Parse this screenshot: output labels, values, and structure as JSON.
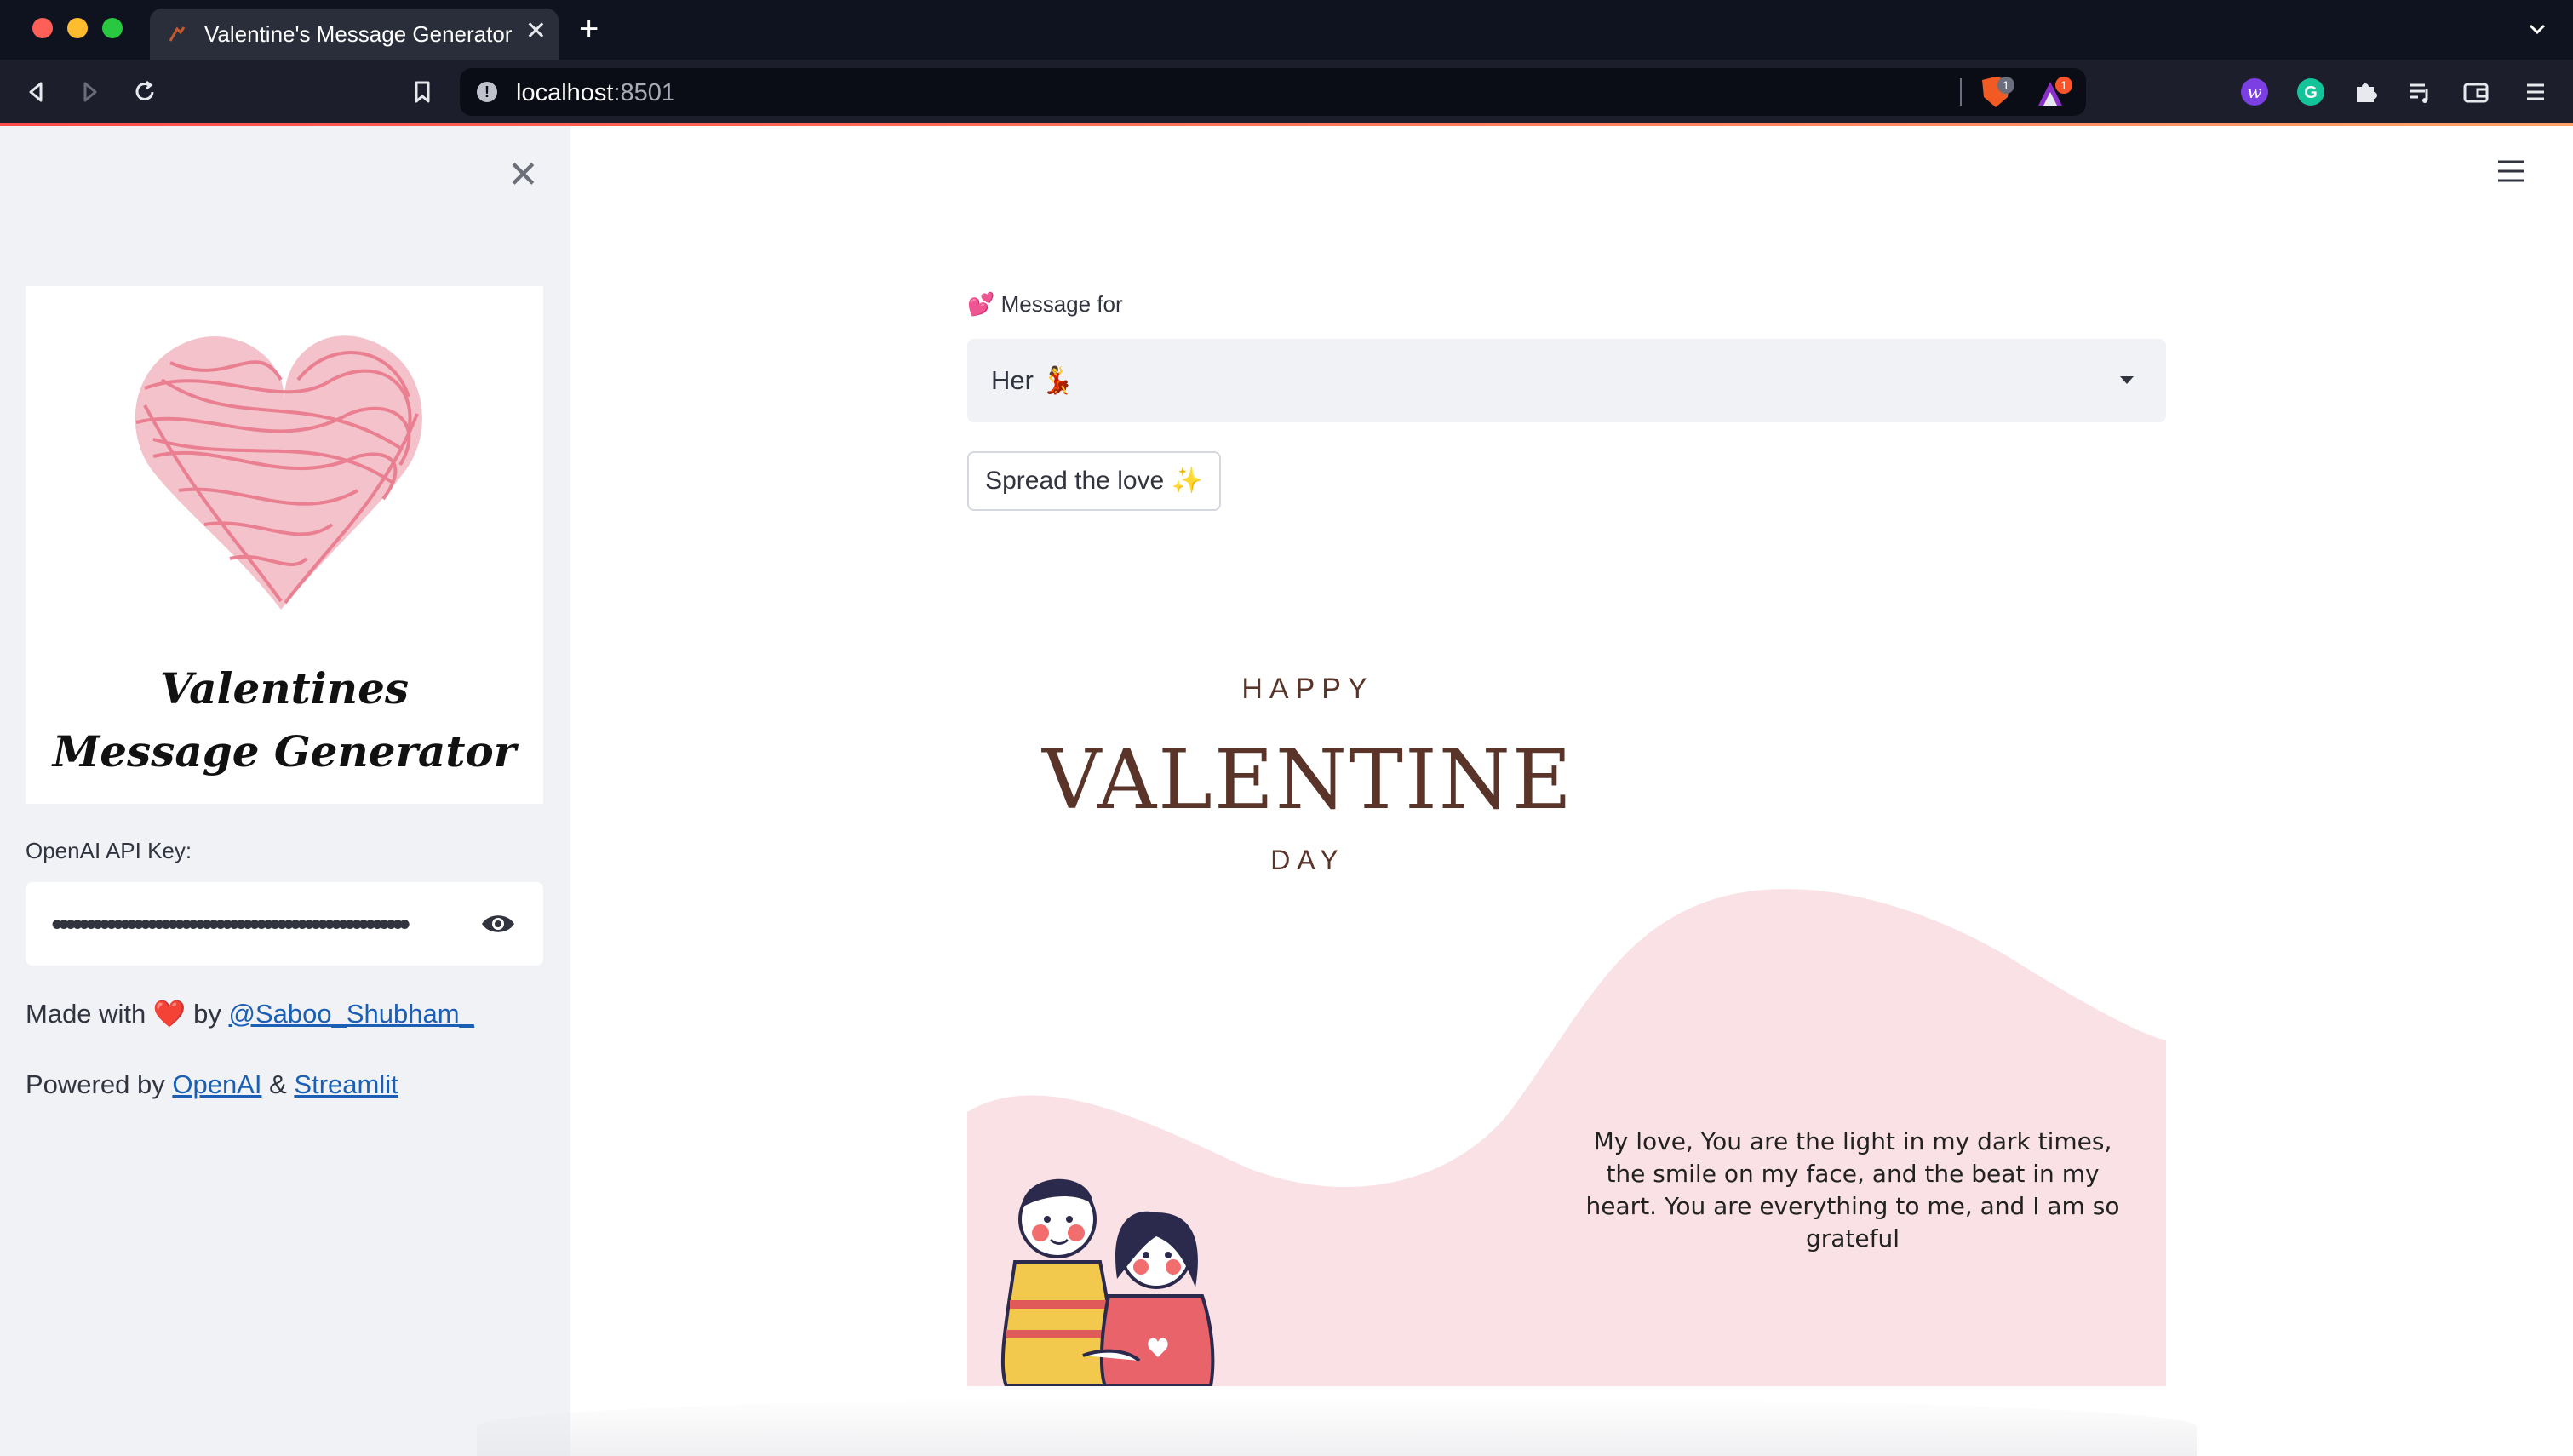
{
  "browser": {
    "tab_title": "Valentine's Message Generator",
    "tab_close": "✕",
    "new_tab": "+",
    "url_host": "localhost",
    "url_port": ":8501",
    "shield_badge": "1",
    "rewards_badge": "1"
  },
  "sidebar": {
    "close": "✕",
    "logo_line1": "Valentines",
    "logo_line2": "Message Generator",
    "api_label": "OpenAI API Key:",
    "api_value": "••••••••••••••••••••••••••••••••••••••••••••••••••••",
    "made_prefix": "Made with",
    "made_heart": "❤️",
    "made_by": "by",
    "made_link": "@Saboo_Shubham_",
    "powered_prefix": "Powered by",
    "powered_link1": "OpenAI",
    "powered_amp": "&",
    "powered_link2": "Streamlit"
  },
  "main": {
    "field_label": "💕 Message for",
    "select_value": "Her 💃",
    "button_label": "Spread the love ✨"
  },
  "card": {
    "happy": "HAPPY",
    "valentine": "VALENTINE",
    "day": "DAY",
    "message": "My love,  You are the light in my dark times, the smile on my face, and the beat in my heart. You are everything to me, and I am so grateful"
  },
  "colors": {
    "accent": "#ff4b4b",
    "sidebar_bg": "#f0f2f6",
    "card_pink": "#f9e1e5",
    "heart_pink": "#e8788a",
    "brown": "#5a3428",
    "link": "#1a5fb4"
  }
}
